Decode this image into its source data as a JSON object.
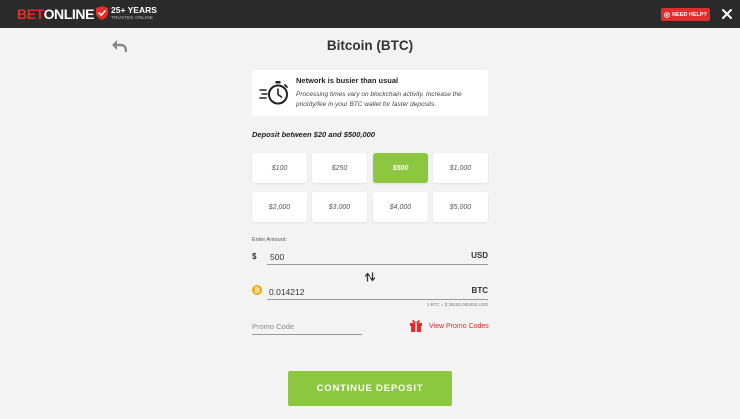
{
  "header": {
    "logo_bet": "BET",
    "logo_online": "ONLINE",
    "badge_big": "25+ YEARS",
    "badge_small": "TRUSTED ONLINE",
    "help_label": "NEED HELP?",
    "close_icon": "close-icon"
  },
  "page": {
    "title": "Bitcoin (BTC)",
    "back_icon": "back-arrow-icon"
  },
  "notice": {
    "title": "Network is busier than usual",
    "text": "Processing times vary on blockchain activity. Increase the priority/fee in your BTC wallet for faster deposits.",
    "icon": "stopwatch-icon"
  },
  "deposit": {
    "range_label": "Deposit between $20 and $500,000",
    "amounts": [
      "$100",
      "$250",
      "$500",
      "$1,000",
      "$2,000",
      "$3,000",
      "$4,000",
      "$5,000"
    ],
    "selected": "$500",
    "enter_label": "Enter Amount:",
    "usd_symbol": "$",
    "usd_value": "500",
    "usd_unit": "USD",
    "btc_value": "0.014212",
    "btc_unit": "BTC",
    "rate": "1 BTC = $ 35182.083453 USD"
  },
  "promo": {
    "placeholder": "Promo Code",
    "view_label": "View Promo Codes"
  },
  "cta_label": "CONTINUE DEPOSIT",
  "colors": {
    "accent_green": "#8dc63f",
    "brand_red": "#e02d2d",
    "header_bg": "#2b2b2b",
    "bitcoin_orange": "#f2a900"
  }
}
